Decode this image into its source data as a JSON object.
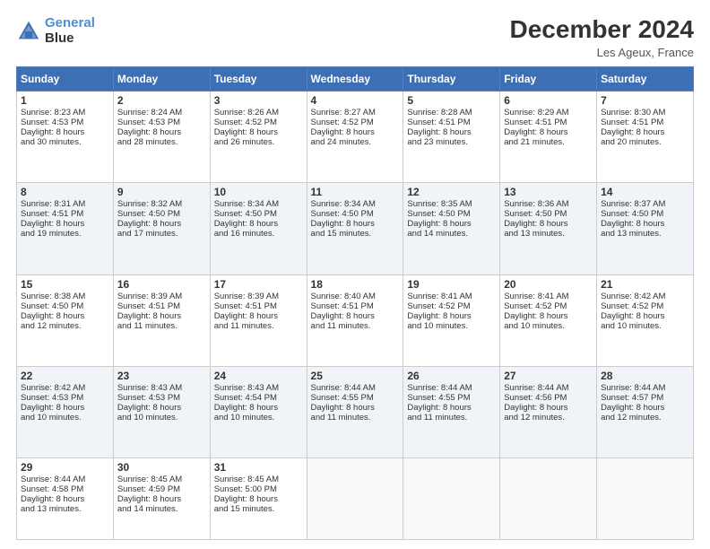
{
  "header": {
    "logo_line1": "General",
    "logo_line2": "Blue",
    "month": "December 2024",
    "location": "Les Ageux, France"
  },
  "days_of_week": [
    "Sunday",
    "Monday",
    "Tuesday",
    "Wednesday",
    "Thursday",
    "Friday",
    "Saturday"
  ],
  "weeks": [
    [
      {
        "day": 1,
        "lines": [
          "Sunrise: 8:23 AM",
          "Sunset: 4:53 PM",
          "Daylight: 8 hours",
          "and 30 minutes."
        ]
      },
      {
        "day": 2,
        "lines": [
          "Sunrise: 8:24 AM",
          "Sunset: 4:53 PM",
          "Daylight: 8 hours",
          "and 28 minutes."
        ]
      },
      {
        "day": 3,
        "lines": [
          "Sunrise: 8:26 AM",
          "Sunset: 4:52 PM",
          "Daylight: 8 hours",
          "and 26 minutes."
        ]
      },
      {
        "day": 4,
        "lines": [
          "Sunrise: 8:27 AM",
          "Sunset: 4:52 PM",
          "Daylight: 8 hours",
          "and 24 minutes."
        ]
      },
      {
        "day": 5,
        "lines": [
          "Sunrise: 8:28 AM",
          "Sunset: 4:51 PM",
          "Daylight: 8 hours",
          "and 23 minutes."
        ]
      },
      {
        "day": 6,
        "lines": [
          "Sunrise: 8:29 AM",
          "Sunset: 4:51 PM",
          "Daylight: 8 hours",
          "and 21 minutes."
        ]
      },
      {
        "day": 7,
        "lines": [
          "Sunrise: 8:30 AM",
          "Sunset: 4:51 PM",
          "Daylight: 8 hours",
          "and 20 minutes."
        ]
      }
    ],
    [
      {
        "day": 8,
        "lines": [
          "Sunrise: 8:31 AM",
          "Sunset: 4:51 PM",
          "Daylight: 8 hours",
          "and 19 minutes."
        ]
      },
      {
        "day": 9,
        "lines": [
          "Sunrise: 8:32 AM",
          "Sunset: 4:50 PM",
          "Daylight: 8 hours",
          "and 17 minutes."
        ]
      },
      {
        "day": 10,
        "lines": [
          "Sunrise: 8:34 AM",
          "Sunset: 4:50 PM",
          "Daylight: 8 hours",
          "and 16 minutes."
        ]
      },
      {
        "day": 11,
        "lines": [
          "Sunrise: 8:34 AM",
          "Sunset: 4:50 PM",
          "Daylight: 8 hours",
          "and 15 minutes."
        ]
      },
      {
        "day": 12,
        "lines": [
          "Sunrise: 8:35 AM",
          "Sunset: 4:50 PM",
          "Daylight: 8 hours",
          "and 14 minutes."
        ]
      },
      {
        "day": 13,
        "lines": [
          "Sunrise: 8:36 AM",
          "Sunset: 4:50 PM",
          "Daylight: 8 hours",
          "and 13 minutes."
        ]
      },
      {
        "day": 14,
        "lines": [
          "Sunrise: 8:37 AM",
          "Sunset: 4:50 PM",
          "Daylight: 8 hours",
          "and 13 minutes."
        ]
      }
    ],
    [
      {
        "day": 15,
        "lines": [
          "Sunrise: 8:38 AM",
          "Sunset: 4:50 PM",
          "Daylight: 8 hours",
          "and 12 minutes."
        ]
      },
      {
        "day": 16,
        "lines": [
          "Sunrise: 8:39 AM",
          "Sunset: 4:51 PM",
          "Daylight: 8 hours",
          "and 11 minutes."
        ]
      },
      {
        "day": 17,
        "lines": [
          "Sunrise: 8:39 AM",
          "Sunset: 4:51 PM",
          "Daylight: 8 hours",
          "and 11 minutes."
        ]
      },
      {
        "day": 18,
        "lines": [
          "Sunrise: 8:40 AM",
          "Sunset: 4:51 PM",
          "Daylight: 8 hours",
          "and 11 minutes."
        ]
      },
      {
        "day": 19,
        "lines": [
          "Sunrise: 8:41 AM",
          "Sunset: 4:52 PM",
          "Daylight: 8 hours",
          "and 10 minutes."
        ]
      },
      {
        "day": 20,
        "lines": [
          "Sunrise: 8:41 AM",
          "Sunset: 4:52 PM",
          "Daylight: 8 hours",
          "and 10 minutes."
        ]
      },
      {
        "day": 21,
        "lines": [
          "Sunrise: 8:42 AM",
          "Sunset: 4:52 PM",
          "Daylight: 8 hours",
          "and 10 minutes."
        ]
      }
    ],
    [
      {
        "day": 22,
        "lines": [
          "Sunrise: 8:42 AM",
          "Sunset: 4:53 PM",
          "Daylight: 8 hours",
          "and 10 minutes."
        ]
      },
      {
        "day": 23,
        "lines": [
          "Sunrise: 8:43 AM",
          "Sunset: 4:53 PM",
          "Daylight: 8 hours",
          "and 10 minutes."
        ]
      },
      {
        "day": 24,
        "lines": [
          "Sunrise: 8:43 AM",
          "Sunset: 4:54 PM",
          "Daylight: 8 hours",
          "and 10 minutes."
        ]
      },
      {
        "day": 25,
        "lines": [
          "Sunrise: 8:44 AM",
          "Sunset: 4:55 PM",
          "Daylight: 8 hours",
          "and 11 minutes."
        ]
      },
      {
        "day": 26,
        "lines": [
          "Sunrise: 8:44 AM",
          "Sunset: 4:55 PM",
          "Daylight: 8 hours",
          "and 11 minutes."
        ]
      },
      {
        "day": 27,
        "lines": [
          "Sunrise: 8:44 AM",
          "Sunset: 4:56 PM",
          "Daylight: 8 hours",
          "and 12 minutes."
        ]
      },
      {
        "day": 28,
        "lines": [
          "Sunrise: 8:44 AM",
          "Sunset: 4:57 PM",
          "Daylight: 8 hours",
          "and 12 minutes."
        ]
      }
    ],
    [
      {
        "day": 29,
        "lines": [
          "Sunrise: 8:44 AM",
          "Sunset: 4:58 PM",
          "Daylight: 8 hours",
          "and 13 minutes."
        ]
      },
      {
        "day": 30,
        "lines": [
          "Sunrise: 8:45 AM",
          "Sunset: 4:59 PM",
          "Daylight: 8 hours",
          "and 14 minutes."
        ]
      },
      {
        "day": 31,
        "lines": [
          "Sunrise: 8:45 AM",
          "Sunset: 5:00 PM",
          "Daylight: 8 hours",
          "and 15 minutes."
        ]
      },
      null,
      null,
      null,
      null
    ]
  ]
}
